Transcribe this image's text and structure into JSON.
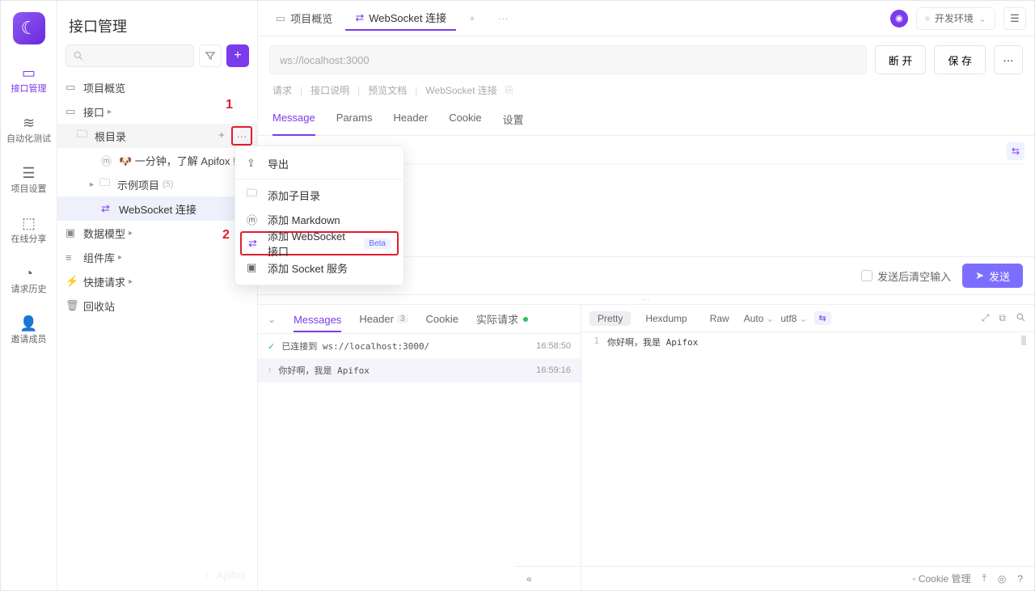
{
  "iconbar": {
    "items": [
      {
        "label": "接口管理"
      },
      {
        "label": "自动化测试"
      },
      {
        "label": "项目设置"
      },
      {
        "label": "在线分享"
      },
      {
        "label": "请求历史"
      },
      {
        "label": "邀请成员"
      }
    ]
  },
  "tree": {
    "title": "接口管理",
    "overview": "项目概览",
    "api_root": "接口",
    "root_dir": "根目录",
    "item_learn": "🐶 一分钟，了解 Apifox !",
    "item_sample": "示例项目",
    "sample_count": "(5)",
    "item_ws": "WebSocket 连接",
    "data_model": "数据模型",
    "components": "组件库",
    "quick_req": "快捷请求",
    "recycle": "回收站"
  },
  "annotations": {
    "a1": "1",
    "a2": "2"
  },
  "ctx": {
    "export": "导出",
    "add_sub": "添加子目录",
    "add_md": "添加 Markdown",
    "add_ws": "添加 WebSocket 接口",
    "beta": "Beta",
    "add_socket": "添加 Socket 服务"
  },
  "topbar": {
    "tab1": "项目概览",
    "tab2": "WebSocket 连接",
    "env_label": "开发环境"
  },
  "url": {
    "text": "ws://localhost:3000"
  },
  "buttons": {
    "disconnect": "断 开",
    "save": "保 存",
    "send": "发送"
  },
  "breadcrumb": {
    "b1": "请求",
    "b2": "接口说明",
    "b3": "预览文档",
    "b4": "WebSocket 连接"
  },
  "subtabs": {
    "t1": "Message",
    "t2": "Params",
    "t3": "Header",
    "t4": "Cookie",
    "t5": "设置"
  },
  "send_row": {
    "clear_label": "发送后清空输入"
  },
  "msgtabs": {
    "t1": "Messages",
    "t2": "Header",
    "t2_count": "3",
    "t3": "Cookie",
    "t4": "实际请求"
  },
  "msgs": [
    {
      "kind": "ok",
      "txt": "已连接到 ws://localhost:3000/",
      "time": "16:58:50"
    },
    {
      "kind": "sent",
      "txt": "你好啊，我是 Apifox",
      "time": "16:59:16"
    }
  ],
  "viewer": {
    "p1": "Pretty",
    "p2": "Hexdump",
    "p3": "Raw",
    "dd1": "Auto",
    "dd2": "utf8",
    "line": "1",
    "body": "你好啊，我是 Apifox"
  },
  "footer": {
    "cookie": "Cookie 管理"
  },
  "watermark": "Apifox"
}
